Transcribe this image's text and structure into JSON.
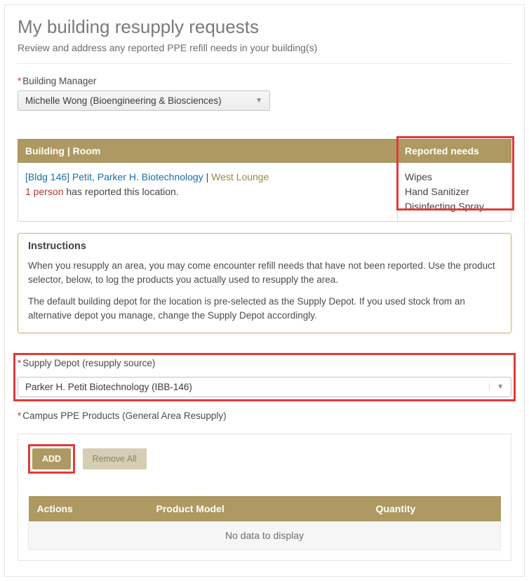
{
  "header": {
    "title": "My building resupply requests",
    "subtitle": "Review and address any reported PPE refill needs in your building(s)"
  },
  "manager": {
    "label": "Building Manager",
    "value": "Michelle Wong (Bioengineering & Biosciences)"
  },
  "report_table": {
    "col_building": "Building | Room",
    "col_needs": "Reported needs",
    "row": {
      "bldg": "[Bldg 146] Petit, Parker H. Biotechnology",
      "sep": " | ",
      "room": "West Lounge",
      "people_count": "1 person",
      "people_suffix": " has reported this location.",
      "needs": [
        "Wipes",
        "Hand Sanitizer",
        "Disinfecting Spray"
      ]
    }
  },
  "instructions": {
    "heading": "Instructions",
    "p1": "When you resupply an area, you may come encounter refill needs that have not been reported. Use the product selector, below, to log the products you actually used to resupply the area.",
    "p2": "The default building depot for the location is pre-selected as the Supply Depot. If you used stock from an alternative depot you manage, change the Supply Depot accordingly."
  },
  "depot": {
    "label": "Supply Depot (resupply source)",
    "value": "Parker H. Petit Biotechnology (IBB-146)"
  },
  "products": {
    "label": "Campus PPE Products (General Area Resupply)",
    "add": "ADD",
    "remove_all": "Remove All",
    "col_actions": "Actions",
    "col_model": "Product Model",
    "col_qty": "Quantity",
    "nodata": "No data to display"
  }
}
